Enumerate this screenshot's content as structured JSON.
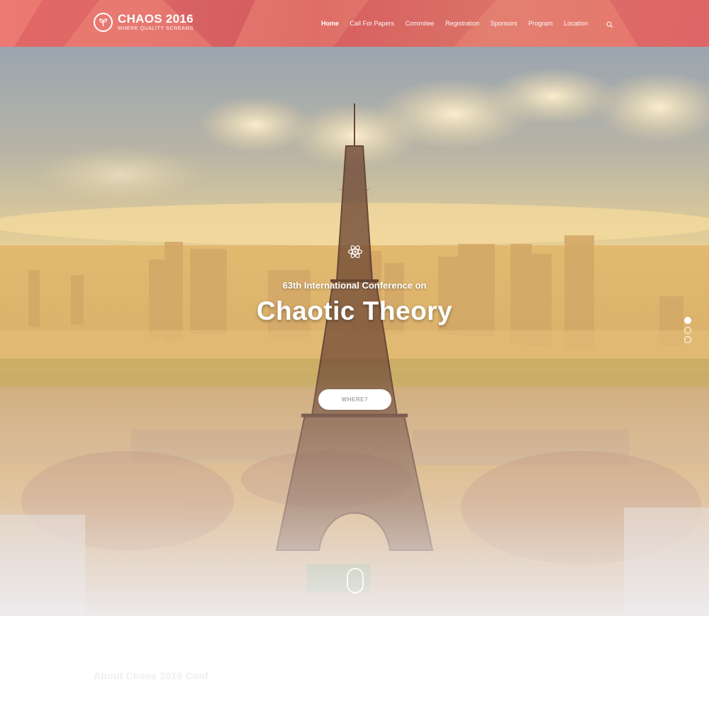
{
  "header": {
    "logo_title": "CHAOS 2016",
    "logo_subtitle": "WHERE QUALITY SCREAMS",
    "logo_icon": "sprout-icon",
    "nav": [
      {
        "label": "Home",
        "active": true
      },
      {
        "label": "Call For Papers",
        "active": false
      },
      {
        "label": "Commitee",
        "active": false
      },
      {
        "label": "Registration",
        "active": false
      },
      {
        "label": "Sponsors",
        "active": false
      },
      {
        "label": "Program",
        "active": false
      },
      {
        "label": "Location",
        "active": false
      }
    ],
    "search_icon": "search-icon",
    "background_color": "#e5706d"
  },
  "hero": {
    "icon": "atom-icon",
    "subtitle": "63th International Conference on",
    "title": "Chaotic Theory",
    "button_label": "WHERE?",
    "slide_count": 3,
    "active_slide": 1
  },
  "about": {
    "heading": "About Chaos 2016 Conf"
  }
}
